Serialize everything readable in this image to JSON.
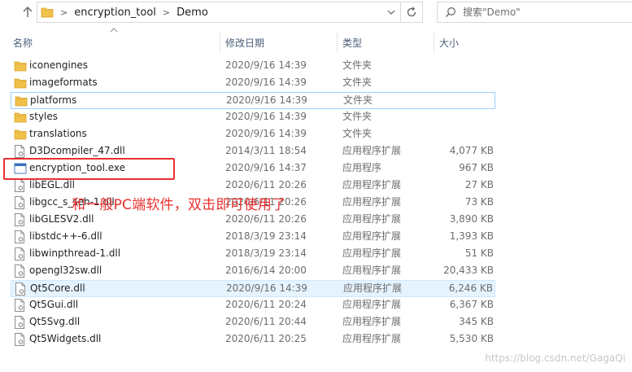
{
  "address_bar": {
    "path": [
      "encryption_tool",
      "Demo"
    ],
    "search_placeholder": "搜索\"Demo\""
  },
  "columns": {
    "name": "名称",
    "date": "修改日期",
    "type": "类型",
    "size": "大小"
  },
  "files": [
    {
      "name": "iconengines",
      "date": "2020/9/16 14:39",
      "type": "文件夹",
      "size": "",
      "icon": "folder-icon"
    },
    {
      "name": "imageformats",
      "date": "2020/9/16 14:39",
      "type": "文件夹",
      "size": "",
      "icon": "folder-icon"
    },
    {
      "name": "platforms",
      "date": "2020/9/16 14:39",
      "type": "文件夹",
      "size": "",
      "icon": "folder-icon"
    },
    {
      "name": "styles",
      "date": "2020/9/16 14:39",
      "type": "文件夹",
      "size": "",
      "icon": "folder-icon"
    },
    {
      "name": "translations",
      "date": "2020/9/16 14:39",
      "type": "文件夹",
      "size": "",
      "icon": "folder-icon"
    },
    {
      "name": "D3Dcompiler_47.dll",
      "date": "2014/3/11 18:54",
      "type": "应用程序扩展",
      "size": "4,077 KB",
      "icon": "dll-file-icon"
    },
    {
      "name": "encryption_tool.exe",
      "date": "2020/9/16 14:37",
      "type": "应用程序",
      "size": "967 KB",
      "icon": "exe-file-icon"
    },
    {
      "name": "libEGL.dll",
      "date": "2020/6/11 20:26",
      "type": "应用程序扩展",
      "size": "27 KB",
      "icon": "dll-file-icon"
    },
    {
      "name": "libgcc_s_seh-1.dll",
      "date": "2020/6/11 20:26",
      "type": "应用程序扩展",
      "size": "73 KB",
      "icon": "dll-file-icon"
    },
    {
      "name": "libGLESV2.dll",
      "date": "2020/6/11 20:26",
      "type": "应用程序扩展",
      "size": "3,890 KB",
      "icon": "dll-file-icon"
    },
    {
      "name": "libstdc++-6.dll",
      "date": "2018/3/19 23:14",
      "type": "应用程序扩展",
      "size": "1,393 KB",
      "icon": "dll-file-icon"
    },
    {
      "name": "libwinpthread-1.dll",
      "date": "2018/3/19 23:14",
      "type": "应用程序扩展",
      "size": "51 KB",
      "icon": "dll-file-icon"
    },
    {
      "name": "opengl32sw.dll",
      "date": "2016/6/14 20:00",
      "type": "应用程序扩展",
      "size": "20,433 KB",
      "icon": "dll-file-icon"
    },
    {
      "name": "Qt5Core.dll",
      "date": "2020/9/16 14:39",
      "type": "应用程序扩展",
      "size": "6,246 KB",
      "icon": "dll-file-icon"
    },
    {
      "name": "Qt5Gui.dll",
      "date": "2020/6/11 20:24",
      "type": "应用程序扩展",
      "size": "6,367 KB",
      "icon": "dll-file-icon"
    },
    {
      "name": "Qt5Svg.dll",
      "date": "2020/6/11 20:44",
      "type": "应用程序扩展",
      "size": "345 KB",
      "icon": "dll-file-icon"
    },
    {
      "name": "Qt5Widgets.dll",
      "date": "2020/6/11 20:25",
      "type": "应用程序扩展",
      "size": "5,530 KB",
      "icon": "dll-file-icon"
    }
  ],
  "annotation": {
    "text": "和一般PC端软件，双击即可使用了"
  },
  "watermark": "https://blog.csdn.net/GagaQi",
  "colors": {
    "selection": "#e5f3ff",
    "annotation_red": "#e8312f",
    "folder": "#f0c24b"
  }
}
